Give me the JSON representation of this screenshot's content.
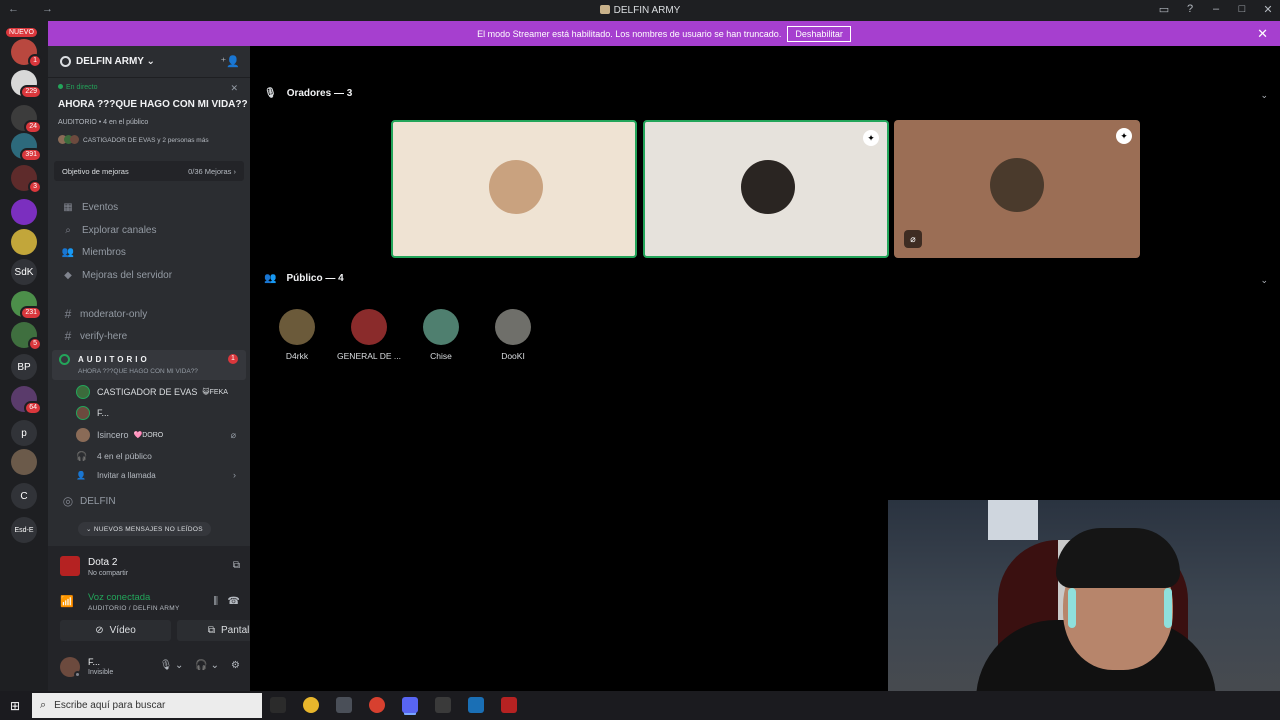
{
  "window": {
    "title": "DELFIN ARMY",
    "nav_glyphs": "← →",
    "controls": [
      "▭",
      "?",
      "–",
      "□",
      "✕"
    ]
  },
  "banner": {
    "text": "El modo Streamer está habilitado. Los nombres de usuario se han truncado.",
    "button": "Deshabilitar",
    "close": "✕"
  },
  "rail": {
    "nuevo": "NUEVO",
    "servers": [
      {
        "label": "",
        "badge": "1",
        "color": "#b9483f"
      },
      {
        "label": "",
        "badge": "229",
        "color": "#d8d8d8"
      },
      {
        "label": "",
        "badge": "24",
        "color": "#3c3c3c"
      },
      {
        "label": "",
        "badge": "391",
        "color": "#2d6a7c"
      },
      {
        "label": "",
        "badge": "3",
        "color": "#5e2b2b"
      },
      {
        "label": "",
        "badge": "",
        "color": "#7b2fbf"
      },
      {
        "label": "",
        "badge": "",
        "color": "#c2a63a"
      },
      {
        "label": "SdK",
        "badge": "",
        "color": "#313338"
      },
      {
        "label": "",
        "badge": "231",
        "color": "#4c8f4a"
      },
      {
        "label": "",
        "badge": "5",
        "color": "#3f6f3f"
      },
      {
        "label": "BP",
        "badge": "",
        "color": "#313338"
      },
      {
        "label": "",
        "badge": "64",
        "color": "#5a3b6b"
      },
      {
        "label": "p",
        "badge": "",
        "color": "#313338"
      },
      {
        "label": "",
        "badge": "",
        "color": "#6b5a4a"
      },
      {
        "label": "C",
        "badge": "",
        "color": "#313338"
      },
      {
        "label": "Esd-E",
        "badge": "",
        "color": "#313338"
      }
    ]
  },
  "sidebar": {
    "server_name": "DELFIN ARMY ⌄",
    "live": {
      "status": "En directo",
      "close": "✕",
      "topic": "AHORA ???QUE HAGO CON MI VIDA??",
      "meta": "AUDITORIO • 4 en el público",
      "people": "CASTIGADOR DE EVAS y 2 personas más"
    },
    "goal": {
      "label": "Objetivo de mejoras",
      "value": "0/36 Mejoras ›"
    },
    "nav": [
      {
        "icon": "▦",
        "label": "Eventos"
      },
      {
        "icon": "⌕",
        "label": "Explorar canales"
      },
      {
        "icon": "👥",
        "label": "Miembros"
      },
      {
        "icon": "◆",
        "label": "Mejoras del servidor"
      }
    ],
    "channels": [
      {
        "icon": "#",
        "label": "moderator-only"
      },
      {
        "icon": "#",
        "label": "verify-here"
      }
    ],
    "stage_channel": {
      "name": "AUDITORIO",
      "topic": "AHORA ???QUE HAGO CON MI VIDA??",
      "count": "1"
    },
    "voice_users": [
      {
        "name": "CASTIGADOR DE EVAS",
        "tag": "😺FEKA",
        "color": "#3c6b3c",
        "muted": ""
      },
      {
        "name": "F...",
        "tag": "",
        "color": "#6c4a3e",
        "muted": ""
      },
      {
        "name": "Isincero",
        "tag": "🩷DORO",
        "color": "#8a6b57",
        "muted": "⌀"
      }
    ],
    "audience": {
      "icon": "🎧",
      "label": "4 en el público"
    },
    "invite": {
      "icon": "👤",
      "label": "Invitar a llamada",
      "chev": "›"
    },
    "delfin_channel": {
      "icon": "◎",
      "label": "DELFIN"
    },
    "unread": "⌄ NUEVOS MENSAJES NO LEÍDOS"
  },
  "panel": {
    "game": {
      "title": "Dota 2",
      "subtitle": "No compartir",
      "icon": "⧉"
    },
    "voice": {
      "title": "Voz conectada",
      "subtitle": "AUDITORIO / DELFIN ARMY",
      "wave_icon": "⫼",
      "hangup_icon": "☎"
    },
    "video_btn": {
      "icon": "⊘",
      "label": "Vídeo"
    },
    "screen_btn": {
      "icon": "⧉",
      "label": "Pantalla"
    },
    "user": {
      "name": "F...",
      "status": "Invisible",
      "mic": "🎙 ⌄",
      "deafen": "🎧 ⌄",
      "settings": "⚙"
    }
  },
  "stage": {
    "speakers_header": {
      "icon": "🎙",
      "label": "Oradores — 3",
      "chev": "⌄"
    },
    "speakers": [
      {
        "bg": "#efe3d3",
        "border": "#23a55a",
        "face": "#c9a27f",
        "mod": "",
        "muted": ""
      },
      {
        "bg": "#e6e2dc",
        "border": "#23a55a",
        "face": "#2a2522",
        "mod": "✦",
        "muted": ""
      },
      {
        "bg": "#9b6e55",
        "border": "",
        "face": "#4a3a2c",
        "mod": "✦",
        "muted": "⌀"
      }
    ],
    "audience_header": {
      "icon": "👥",
      "label": "Público — 4",
      "chev": "⌄"
    },
    "audience": [
      {
        "name": "D4rkk",
        "color": "#6b5a3a"
      },
      {
        "name": "GENERAL DE ...",
        "color": "#8a2b2b"
      },
      {
        "name": "Chise",
        "color": "#4f7f6f"
      },
      {
        "name": "DooKI",
        "color": "#6f6f6a"
      }
    ]
  },
  "taskbar": {
    "start": "⊞",
    "search_icon": "⌕",
    "search_placeholder": "Escribe aquí para buscar",
    "apps": [
      {
        "name": "task-view",
        "color": "#2b2b2b",
        "active": false
      },
      {
        "name": "chrome",
        "color": "#e8b62c",
        "active": false
      },
      {
        "name": "app-2",
        "color": "#4a4f58",
        "active": false
      },
      {
        "name": "chrome-2",
        "color": "#d7402f",
        "active": false
      },
      {
        "name": "discord",
        "color": "#5865f2",
        "active": true
      },
      {
        "name": "app-5",
        "color": "#3a3a3a",
        "active": false
      },
      {
        "name": "steam",
        "color": "#1a6fb5",
        "active": false
      },
      {
        "name": "dota",
        "color": "#b52222",
        "active": false
      }
    ]
  }
}
